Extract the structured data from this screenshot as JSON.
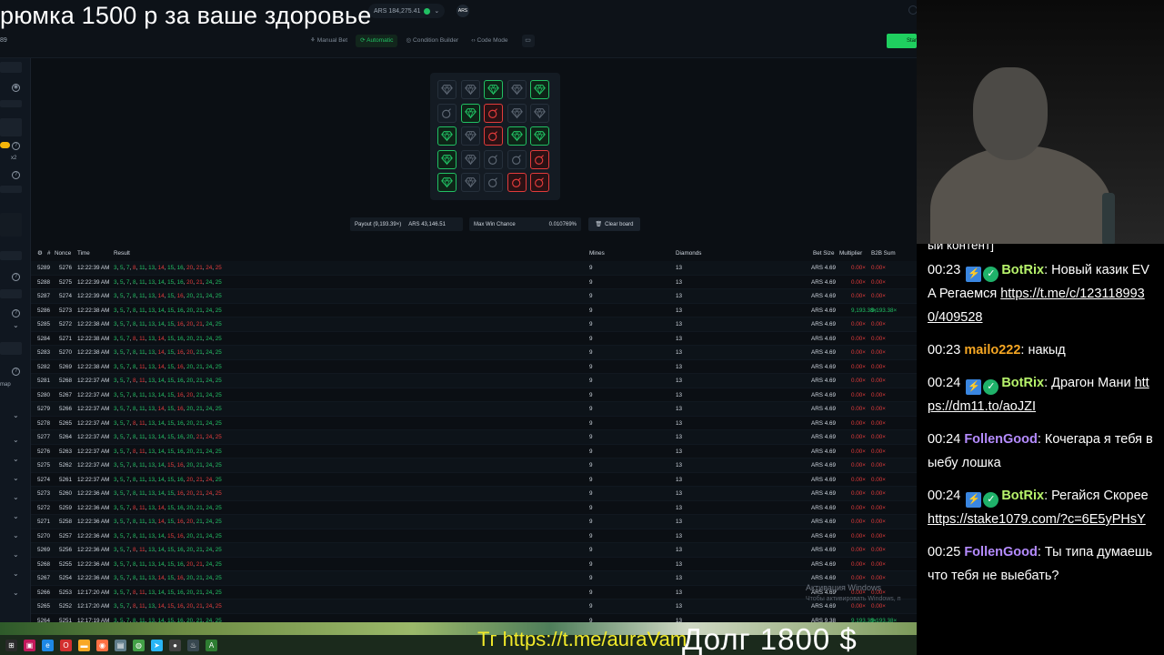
{
  "overlay": {
    "stream_title": "рюмка 1500 р за ваше здоровье",
    "telegram": "Tг https://t.me/auraVam",
    "debt": "Долг 1800 $"
  },
  "header": {
    "balance": "ARS 184,275.41",
    "avatar": "ARS",
    "left_number": "89",
    "start_label": "Start",
    "mode_tabs": [
      {
        "label": "Manual Bet",
        "icon": "bet-icon",
        "active": false
      },
      {
        "label": "Automatic",
        "icon": "auto-icon",
        "active": true
      },
      {
        "label": "Condition Builder",
        "icon": "condition-icon",
        "active": false
      },
      {
        "label": "Code Mode",
        "icon": "code-icon",
        "active": false
      }
    ]
  },
  "sidebar": {
    "chip_x2": "x2",
    "map_label": "map"
  },
  "board": {
    "tiles": [
      "diamond",
      "diamond",
      "gem",
      "diamond",
      "gem",
      "bomb",
      "gem",
      "bomb-red",
      "diamond",
      "diamond",
      "gem",
      "diamond",
      "bomb-red",
      "gem",
      "gem",
      "gem",
      "diamond",
      "bomb",
      "bomb",
      "bomb-red",
      "gem",
      "diamond",
      "bomb",
      "bomb-red",
      "bomb-red"
    ]
  },
  "stats": {
    "payout_label": "Payout (9,193.39×)",
    "payout_value": "ARS 43,146.51",
    "max_win_label": "Max Win Chance",
    "max_win_value": "0.010769%",
    "clear_label": "Clear board"
  },
  "table": {
    "headers": {
      "hash": "#",
      "nonce": "Nonce",
      "time": "Time",
      "result": "Result",
      "mines": "Mines",
      "diamonds": "Diamonds",
      "bet": "Bet Size",
      "mult": "Multiplier",
      "b2b": "B2B Sum"
    },
    "rows": [
      {
        "id": "5289",
        "nonce": "5276",
        "time": "12:22:39 AM",
        "result": "3, 5, 7, 8, 11, 13, 14, 15, 16, 20, 21, 24, 25",
        "mines": "9",
        "dia": "13",
        "bet": "ARS 4.69",
        "mult": "0.00×",
        "b2b": "0.00×",
        "win": false
      },
      {
        "id": "5288",
        "nonce": "5275",
        "time": "12:22:39 AM",
        "result": "3, 5, 7, 8, 11, 13, 14, 15, 16, 20, 21, 24, 25",
        "mines": "9",
        "dia": "13",
        "bet": "ARS 4.69",
        "mult": "0.00×",
        "b2b": "0.00×",
        "win": false
      },
      {
        "id": "5287",
        "nonce": "5274",
        "time": "12:22:39 AM",
        "result": "3, 5, 7, 8, 11, 13, 14, 15, 16, 20, 21, 24, 25",
        "mines": "9",
        "dia": "13",
        "bet": "ARS 4.69",
        "mult": "0.00×",
        "b2b": "0.00×",
        "win": false
      },
      {
        "id": "5286",
        "nonce": "5273",
        "time": "12:22:38 AM",
        "result": "3, 5, 7, 8, 11, 13, 14, 15, 16, 20, 21, 24, 25",
        "mines": "9",
        "dia": "13",
        "bet": "ARS 4.69",
        "mult": "9,193.38×",
        "b2b": "9,193.38×",
        "win": true
      },
      {
        "id": "5285",
        "nonce": "5272",
        "time": "12:22:38 AM",
        "result": "3, 5, 7, 8, 11, 13, 14, 15, 16, 20, 21, 24, 25",
        "mines": "9",
        "dia": "13",
        "bet": "ARS 4.69",
        "mult": "0.00×",
        "b2b": "0.00×",
        "win": false
      },
      {
        "id": "5284",
        "nonce": "5271",
        "time": "12:22:38 AM",
        "result": "3, 5, 7, 8, 11, 13, 14, 15, 16, 20, 21, 24, 25",
        "mines": "9",
        "dia": "13",
        "bet": "ARS 4.69",
        "mult": "0.00×",
        "b2b": "0.00×",
        "win": false
      },
      {
        "id": "5283",
        "nonce": "5270",
        "time": "12:22:38 AM",
        "result": "3, 5, 7, 8, 11, 13, 14, 15, 16, 20, 21, 24, 25",
        "mines": "9",
        "dia": "13",
        "bet": "ARS 4.69",
        "mult": "0.00×",
        "b2b": "0.00×",
        "win": false
      },
      {
        "id": "5282",
        "nonce": "5269",
        "time": "12:22:38 AM",
        "result": "3, 5, 7, 8, 11, 13, 14, 15, 16, 20, 21, 24, 25",
        "mines": "9",
        "dia": "13",
        "bet": "ARS 4.69",
        "mult": "0.00×",
        "b2b": "0.00×",
        "win": false
      },
      {
        "id": "5281",
        "nonce": "5268",
        "time": "12:22:37 AM",
        "result": "3, 5, 7, 8, 11, 13, 14, 15, 16, 20, 21, 24, 25",
        "mines": "9",
        "dia": "13",
        "bet": "ARS 4.69",
        "mult": "0.00×",
        "b2b": "0.00×",
        "win": false
      },
      {
        "id": "5280",
        "nonce": "5267",
        "time": "12:22:37 AM",
        "result": "3, 5, 7, 8, 11, 13, 14, 15, 16, 20, 21, 24, 25",
        "mines": "9",
        "dia": "13",
        "bet": "ARS 4.69",
        "mult": "0.00×",
        "b2b": "0.00×",
        "win": false
      },
      {
        "id": "5279",
        "nonce": "5266",
        "time": "12:22:37 AM",
        "result": "3, 5, 7, 8, 11, 13, 14, 15, 16, 20, 21, 24, 25",
        "mines": "9",
        "dia": "13",
        "bet": "ARS 4.69",
        "mult": "0.00×",
        "b2b": "0.00×",
        "win": false
      },
      {
        "id": "5278",
        "nonce": "5265",
        "time": "12:22:37 AM",
        "result": "3, 5, 7, 8, 11, 13, 14, 15, 16, 20, 21, 24, 25",
        "mines": "9",
        "dia": "13",
        "bet": "ARS 4.69",
        "mult": "0.00×",
        "b2b": "0.00×",
        "win": false
      },
      {
        "id": "5277",
        "nonce": "5264",
        "time": "12:22:37 AM",
        "result": "3, 5, 7, 8, 11, 13, 14, 15, 16, 20, 21, 24, 25",
        "mines": "9",
        "dia": "13",
        "bet": "ARS 4.69",
        "mult": "0.00×",
        "b2b": "0.00×",
        "win": false
      },
      {
        "id": "5276",
        "nonce": "5263",
        "time": "12:22:37 AM",
        "result": "3, 5, 7, 8, 11, 13, 14, 15, 16, 20, 21, 24, 25",
        "mines": "9",
        "dia": "13",
        "bet": "ARS 4.69",
        "mult": "0.00×",
        "b2b": "0.00×",
        "win": false
      },
      {
        "id": "5275",
        "nonce": "5262",
        "time": "12:22:37 AM",
        "result": "3, 5, 7, 8, 11, 13, 14, 15, 16, 20, 21, 24, 25",
        "mines": "9",
        "dia": "13",
        "bet": "ARS 4.69",
        "mult": "0.00×",
        "b2b": "0.00×",
        "win": false
      },
      {
        "id": "5274",
        "nonce": "5261",
        "time": "12:22:37 AM",
        "result": "3, 5, 7, 8, 11, 13, 14, 15, 16, 20, 21, 24, 25",
        "mines": "9",
        "dia": "13",
        "bet": "ARS 4.69",
        "mult": "0.00×",
        "b2b": "0.00×",
        "win": false
      },
      {
        "id": "5273",
        "nonce": "5260",
        "time": "12:22:36 AM",
        "result": "3, 5, 7, 8, 11, 13, 14, 15, 16, 20, 21, 24, 25",
        "mines": "9",
        "dia": "13",
        "bet": "ARS 4.69",
        "mult": "0.00×",
        "b2b": "0.00×",
        "win": false
      },
      {
        "id": "5272",
        "nonce": "5259",
        "time": "12:22:36 AM",
        "result": "3, 5, 7, 8, 11, 13, 14, 15, 16, 20, 21, 24, 25",
        "mines": "9",
        "dia": "13",
        "bet": "ARS 4.69",
        "mult": "0.00×",
        "b2b": "0.00×",
        "win": false
      },
      {
        "id": "5271",
        "nonce": "5258",
        "time": "12:22:36 AM",
        "result": "3, 5, 7, 8, 11, 13, 14, 15, 16, 20, 21, 24, 25",
        "mines": "9",
        "dia": "13",
        "bet": "ARS 4.69",
        "mult": "0.00×",
        "b2b": "0.00×",
        "win": false
      },
      {
        "id": "5270",
        "nonce": "5257",
        "time": "12:22:36 AM",
        "result": "3, 5, 7, 8, 11, 13, 14, 15, 16, 20, 21, 24, 25",
        "mines": "9",
        "dia": "13",
        "bet": "ARS 4.69",
        "mult": "0.00×",
        "b2b": "0.00×",
        "win": false
      },
      {
        "id": "5269",
        "nonce": "5256",
        "time": "12:22:36 AM",
        "result": "3, 5, 7, 8, 11, 13, 14, 15, 16, 20, 21, 24, 25",
        "mines": "9",
        "dia": "13",
        "bet": "ARS 4.69",
        "mult": "0.00×",
        "b2b": "0.00×",
        "win": false
      },
      {
        "id": "5268",
        "nonce": "5255",
        "time": "12:22:36 AM",
        "result": "3, 5, 7, 8, 11, 13, 14, 15, 16, 20, 21, 24, 25",
        "mines": "9",
        "dia": "13",
        "bet": "ARS 4.69",
        "mult": "0.00×",
        "b2b": "0.00×",
        "win": false
      },
      {
        "id": "5267",
        "nonce": "5254",
        "time": "12:22:36 AM",
        "result": "3, 5, 7, 8, 11, 13, 14, 15, 16, 20, 21, 24, 25",
        "mines": "9",
        "dia": "13",
        "bet": "ARS 4.69",
        "mult": "0.00×",
        "b2b": "0.00×",
        "win": false
      },
      {
        "id": "5266",
        "nonce": "5253",
        "time": "12:17:20 AM",
        "result": "3, 5, 7, 8, 11, 13, 14, 15, 16, 20, 21, 24, 25",
        "mines": "9",
        "dia": "13",
        "bet": "ARS 4.69",
        "mult": "0.00×",
        "b2b": "0.00×",
        "win": false
      },
      {
        "id": "5265",
        "nonce": "5252",
        "time": "12:17:20 AM",
        "result": "3, 5, 7, 8, 11, 13, 14, 15, 16, 20, 21, 24, 25",
        "mines": "9",
        "dia": "13",
        "bet": "ARS 4.69",
        "mult": "0.00×",
        "b2b": "0.00×",
        "win": false
      },
      {
        "id": "5264",
        "nonce": "5251",
        "time": "12:17:19 AM",
        "result": "3, 5, 7, 8, 11, 13, 14, 15, 16, 20, 21, 24, 25",
        "mines": "9",
        "dia": "13",
        "bet": "ARS 9.38",
        "mult": "9,193.38×",
        "b2b": "9,193.38×",
        "win": true
      }
    ],
    "red_numbers": [
      [
        "8",
        "14",
        "20",
        "21",
        "24",
        "25"
      ],
      [
        "20",
        "21"
      ],
      [
        "14",
        "16"
      ],
      [],
      [
        "16",
        "20",
        "21"
      ],
      [
        "8",
        "11",
        "14"
      ],
      [
        "14",
        "16",
        "20"
      ],
      [
        "11",
        "14",
        "16"
      ],
      [
        "8",
        "11"
      ],
      [
        "16",
        "20"
      ],
      [
        "14",
        "16"
      ],
      [
        "8",
        "11"
      ],
      [
        "21",
        "24",
        "25"
      ],
      [
        "8",
        "11"
      ],
      [
        "15",
        "16"
      ],
      [
        "20",
        "21",
        "24"
      ],
      [
        "16",
        "20",
        "21",
        "24",
        "25"
      ],
      [
        "8",
        "11",
        "14"
      ],
      [
        "14",
        "16",
        "20"
      ],
      [
        "15",
        "16"
      ],
      [
        "8",
        "11"
      ],
      [
        "20",
        "21"
      ],
      [
        "14",
        "16"
      ],
      [
        "8",
        "11"
      ],
      [
        "8",
        "11",
        "14",
        "15",
        "16",
        "20",
        "21",
        "24",
        "25"
      ],
      []
    ],
    "watermark_title": "Активация Windows",
    "watermark_sub": "Чтобы активировать Windows, п"
  },
  "chat": {
    "partial_top": "ый контент]",
    "messages": [
      {
        "time": "00:23",
        "user": "BotRix",
        "type": "bot",
        "text": ": Новый казик EVA Регаемся ",
        "link": "https://t.me/c/1231189930/409528"
      },
      {
        "time": "00:23",
        "user": "mailo222",
        "type": "u1",
        "text": ": накыд",
        "link": ""
      },
      {
        "time": "00:24",
        "user": "BotRix",
        "type": "bot",
        "text": ": Драгон Мани ",
        "link": "https://dm11.to/aoJZI"
      },
      {
        "time": "00:24",
        "user": "FollenGood",
        "type": "u2",
        "text": ": Кочегара я тебя выебу лошка",
        "link": ""
      },
      {
        "time": "00:24",
        "user": "BotRix",
        "type": "bot",
        "text": ": Регайся Скорее ",
        "link": "https://stake1079.com/?c=6E5yPHsY"
      },
      {
        "time": "00:25",
        "user": "FollenGood",
        "type": "u2",
        "text": ": Ты типа думаешь что тебя не выебать?",
        "link": ""
      }
    ]
  },
  "taskbar": {
    "icons": [
      "task-view-icon",
      "store-icon",
      "edge-icon",
      "opera-icon",
      "folder-icon",
      "firefox-icon",
      "files-icon",
      "chrome-icon",
      "telegram-icon",
      "obs-icon",
      "steam-icon",
      "app-icon"
    ]
  },
  "colors": {
    "accent_green": "#21c063",
    "loss_red": "#e23b3b",
    "background": "#0b0f14",
    "overlay_yellow": "#f2ea2a"
  }
}
